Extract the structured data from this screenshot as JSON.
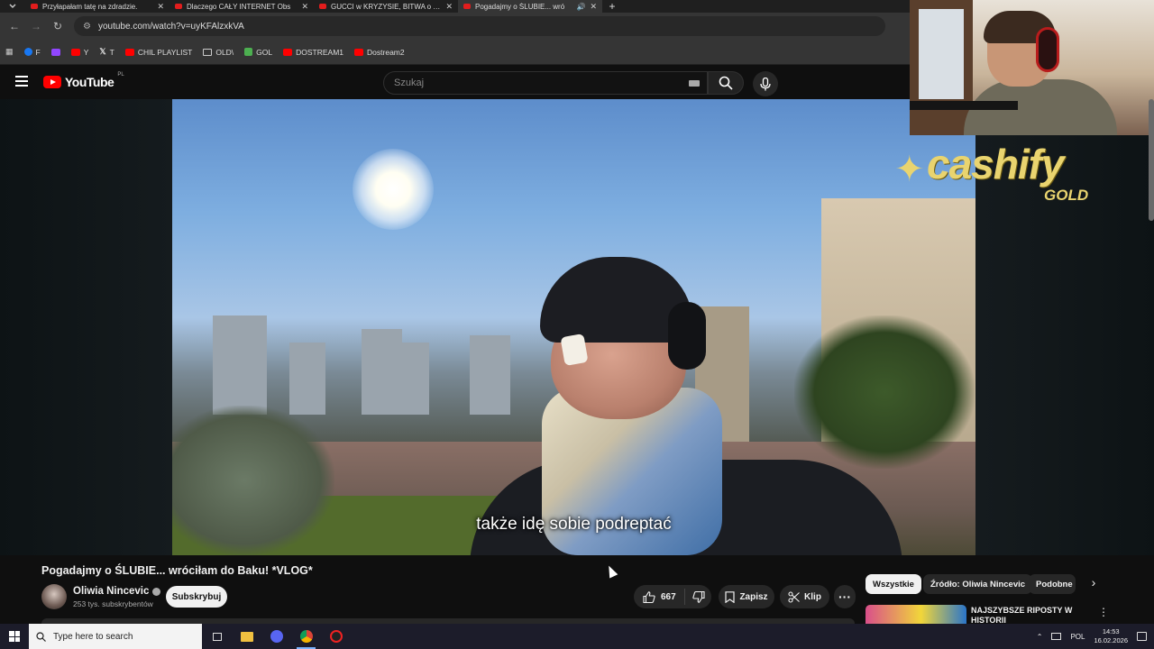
{
  "browser": {
    "tabs": [
      {
        "title": "Przyłapałam tatę na zdradzie.",
        "active": false
      },
      {
        "title": "Dlaczego CAŁY INTERNET Obs",
        "active": false
      },
      {
        "title": "GUCCI w KRYZYSIE, BITWA o TA",
        "active": false
      },
      {
        "title": "Pogadajmy o ŚLUBIE... wró",
        "active": true
      }
    ],
    "new_tab": "+",
    "url": "youtube.com/watch?v=uyKFAlzxkVA",
    "bookmarks": [
      {
        "label": "F",
        "icon": "facebook-icon",
        "color": "#1877f2"
      },
      {
        "label": "",
        "icon": "twitch-icon",
        "color": "#9146ff"
      },
      {
        "label": "Y",
        "icon": "youtube-icon",
        "color": "#ff0000"
      },
      {
        "label": "T",
        "icon": "x-icon",
        "color": "#ffffff"
      },
      {
        "label": "CHIL PLAYLIST",
        "icon": "youtube-icon",
        "color": "#ff0000"
      },
      {
        "label": "OLD\\",
        "icon": "folder-icon",
        "color": "#cccccc"
      },
      {
        "label": "GOL",
        "icon": "g-icon",
        "color": "#4caf50"
      },
      {
        "label": "DOSTREAM1",
        "icon": "youtube-icon",
        "color": "#ff0000"
      },
      {
        "label": "Dostream2",
        "icon": "youtube-icon",
        "color": "#ff0000"
      }
    ]
  },
  "youtube": {
    "logo_text": "YouTube",
    "country_code": "PL",
    "search_placeholder": "Szukaj"
  },
  "video": {
    "subtitle": "także idę sobie podreptać",
    "title": "Pogadajmy o ŚLUBIE... wróciłam do Baku! *VLOG*"
  },
  "overlay": {
    "sponsor_main": "cashify",
    "sponsor_sub": "GOLD"
  },
  "channel": {
    "name": "Oliwia Nincevic",
    "subscribers": "253 tys. subskrybentów",
    "subscribe_label": "Subskrybuj"
  },
  "actions": {
    "likes": "667",
    "save_label": "Zapisz",
    "clip_label": "Klip",
    "more": "···"
  },
  "chips": [
    {
      "label": "Wszystkie",
      "active": true
    },
    {
      "label": "Źródło: Oliwia Nincevic",
      "active": false
    },
    {
      "label": "Podobne",
      "active": false
    }
  ],
  "recommendation": {
    "title": "NAJSZYBSZE RIPOSTY W HISTORII"
  },
  "taskbar": {
    "search_placeholder": "Type here to search",
    "language": "POL",
    "time": "14:53",
    "date": "16.02.2026"
  },
  "colors": {
    "accent_red": "#ff0000",
    "sponsor_gold": "#e9d46f",
    "background": "#0f0f0f"
  }
}
